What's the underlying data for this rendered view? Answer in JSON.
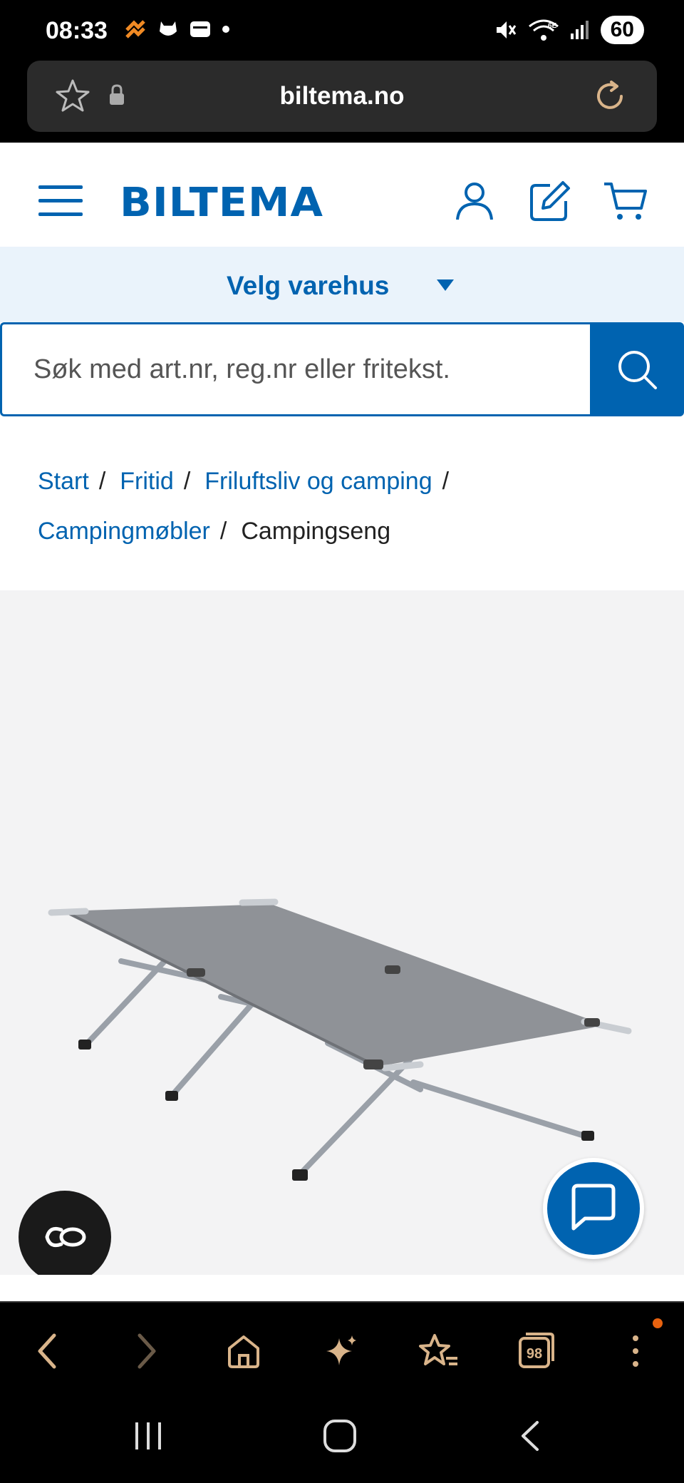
{
  "status_bar": {
    "time": "08:33",
    "battery": "60",
    "icons_left": [
      "flag-icon",
      "cat-icon",
      "wallet-icon",
      "dot-icon"
    ],
    "icons_right": [
      "mute-icon",
      "wifi-6e-icon",
      "signal-icon"
    ]
  },
  "browser": {
    "url": "biltema.no",
    "toolbar": [
      "back",
      "forward",
      "home",
      "ai-sparkle",
      "favorites",
      "tabs",
      "menu"
    ],
    "tab_count": "98"
  },
  "site": {
    "logo": "BILTEMA",
    "store_selector": "Velg varehus",
    "search_placeholder": "Søk med art.nr, reg.nr eller fritekst.",
    "breadcrumb": [
      {
        "label": "Start",
        "link": true
      },
      {
        "label": "Fritid",
        "link": true
      },
      {
        "label": "Friluftsliv og camping",
        "link": true
      },
      {
        "label": "Campingmøbler",
        "link": true
      },
      {
        "label": "Campingseng",
        "link": false
      }
    ],
    "brand_color": "#0063b0"
  },
  "co_button": "CO"
}
